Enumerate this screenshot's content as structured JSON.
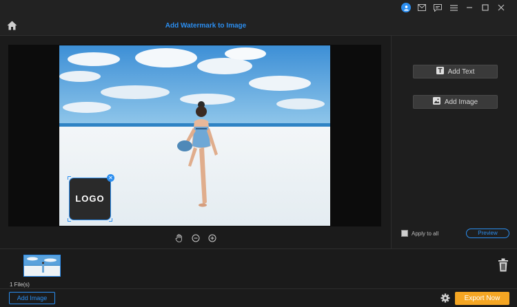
{
  "header": {
    "title": "Add Watermark to Image"
  },
  "watermark": {
    "logo_text": "LOGO"
  },
  "right_panel": {
    "add_text_label": "Add Text",
    "add_image_label": "Add Image",
    "apply_to_all_label": "Apply to all",
    "preview_label": "Preview"
  },
  "file_strip": {
    "count_label": "1 File(s)"
  },
  "footer": {
    "add_image_label": "Add Image",
    "export_label": "Export Now"
  },
  "colors": {
    "accent": "#2b8ef0",
    "export": "#f5a623",
    "background": "#1b1b1b"
  },
  "icons": [
    "user-icon",
    "mail-icon",
    "chat-icon",
    "menu-icon",
    "minimize-icon",
    "maximize-icon",
    "close-icon",
    "home-icon",
    "hand-icon",
    "zoom-out-icon",
    "zoom-in-icon",
    "text-icon",
    "image-icon",
    "trash-icon",
    "gear-icon"
  ]
}
